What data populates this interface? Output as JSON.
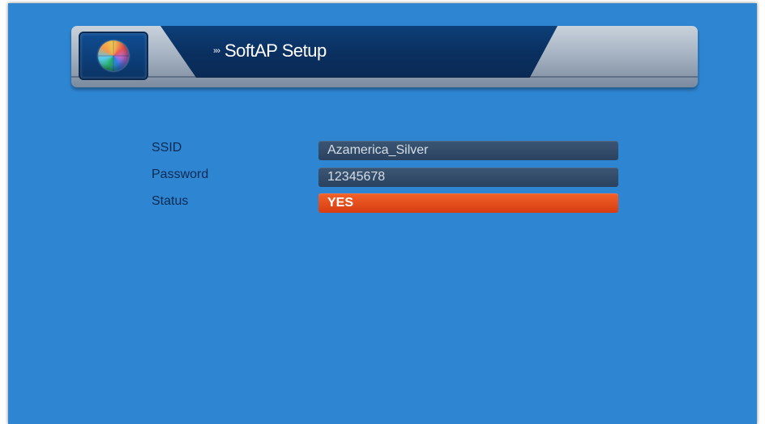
{
  "header": {
    "title_prefix": "›››",
    "title": "SoftAP Setup"
  },
  "form": {
    "ssid": {
      "label": "SSID",
      "value": "Azamerica_Silver"
    },
    "password": {
      "label": "Password",
      "value": "12345678"
    },
    "status": {
      "label": "Status",
      "value": "YES"
    }
  },
  "colors": {
    "background": "#2e86d3",
    "field": "#2f4866",
    "selected_field": "#e44f1c",
    "label": "#0b2a52"
  }
}
